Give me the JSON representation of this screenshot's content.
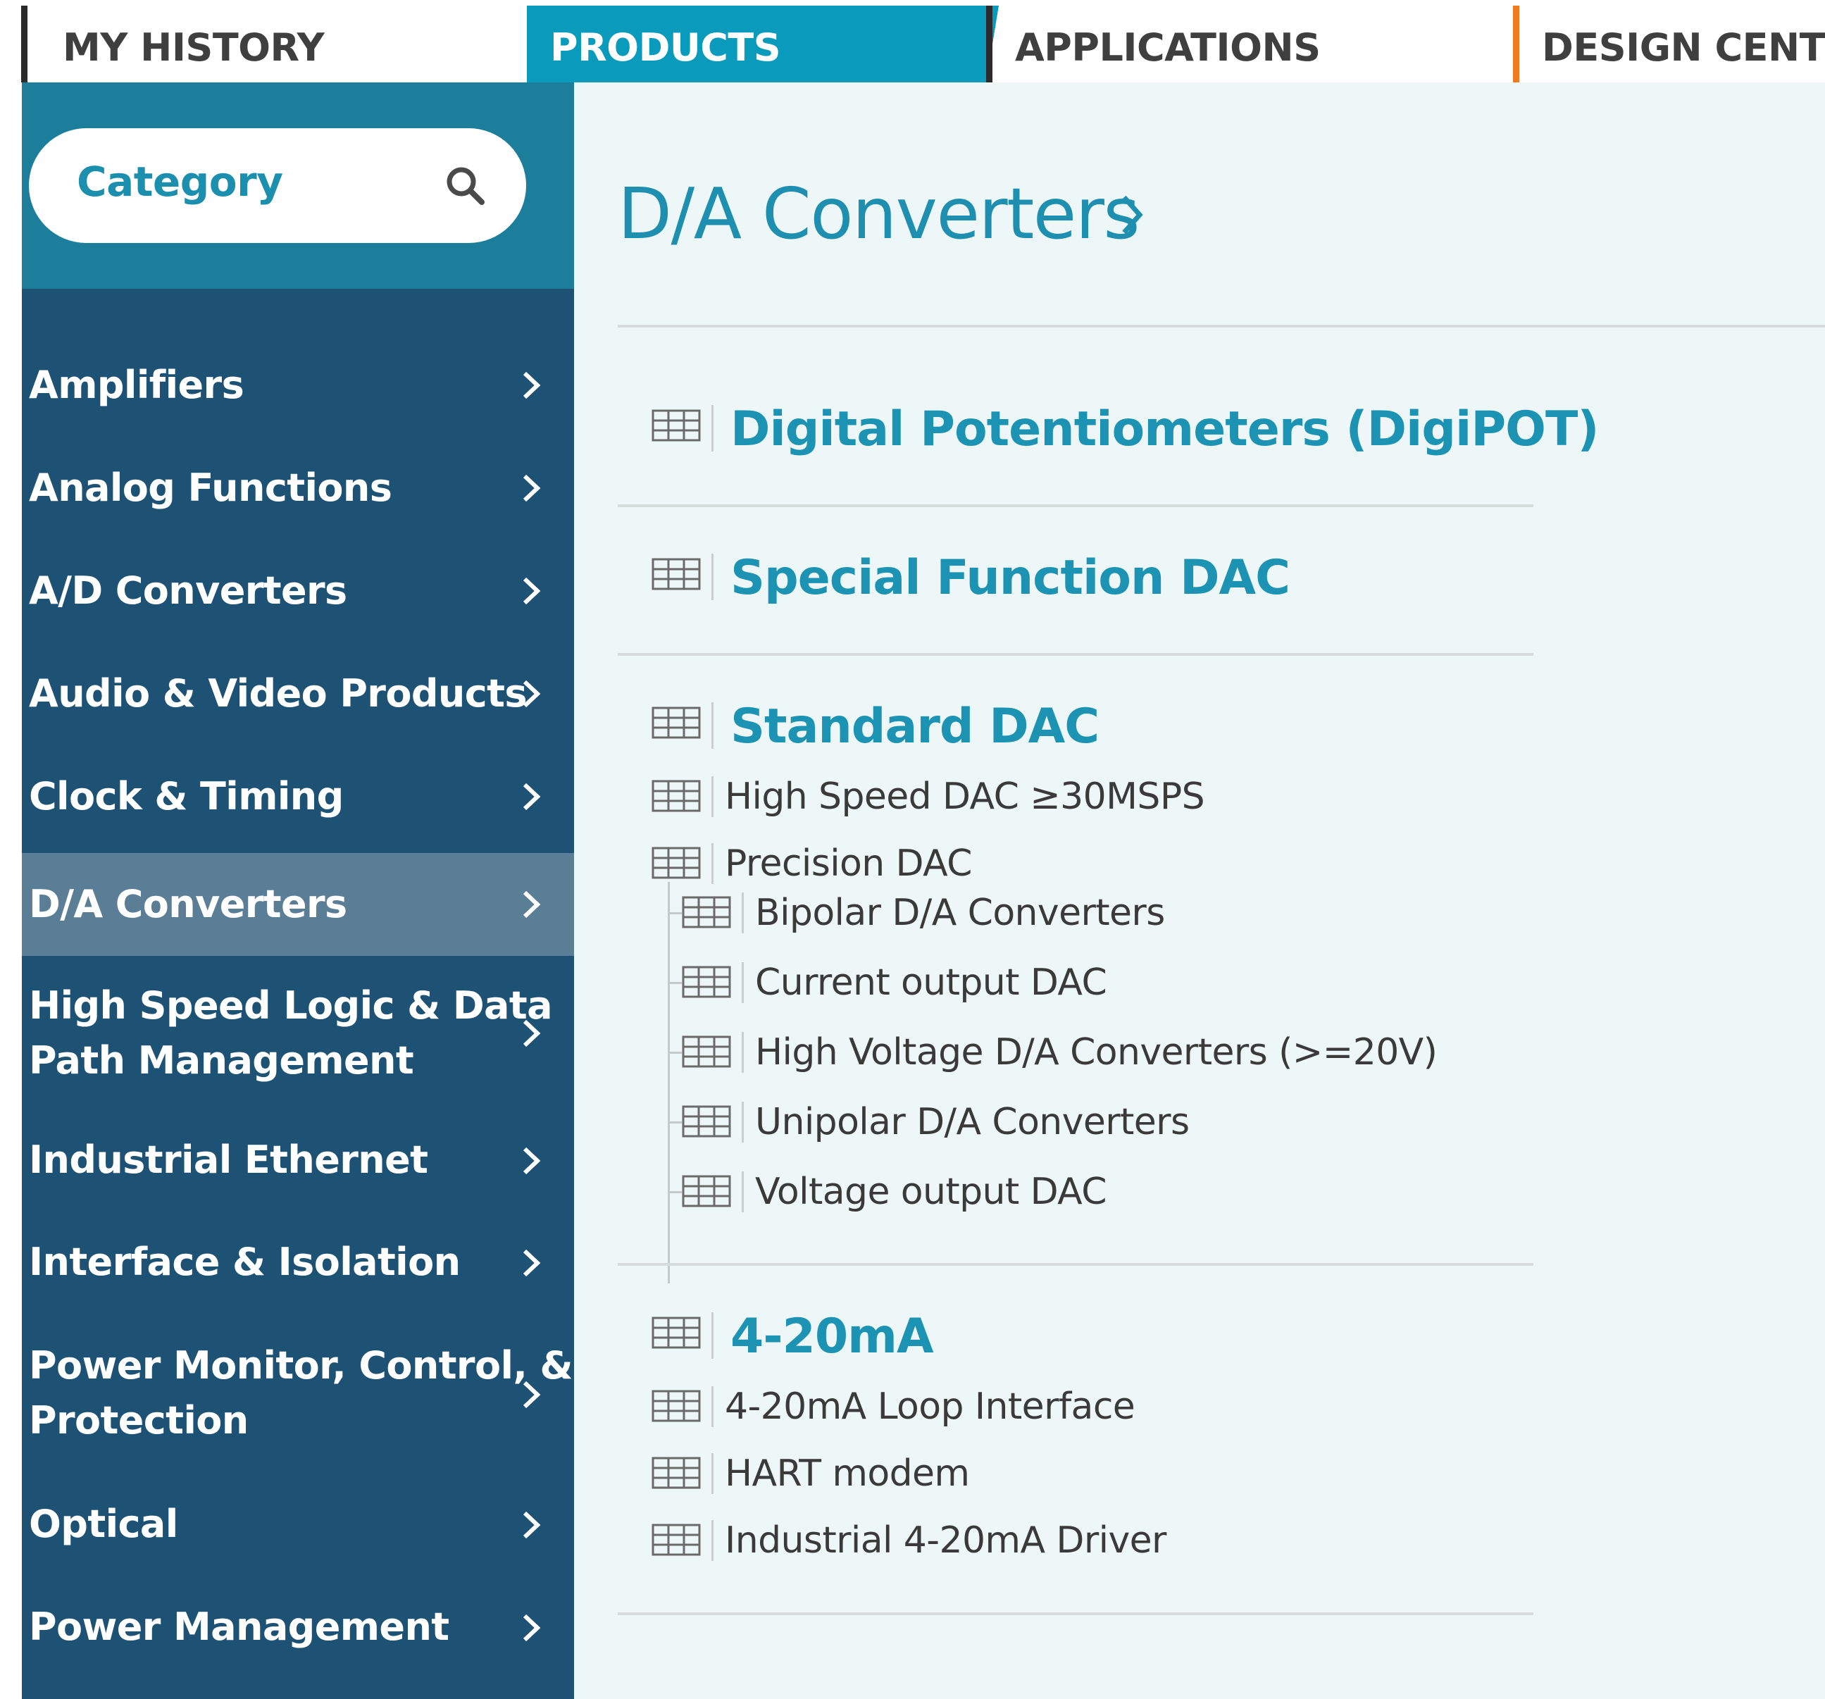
{
  "tabs": {
    "history": "MY HISTORY",
    "products": "PRODUCTS",
    "applications": "APPLICATIONS",
    "design_center": "DESIGN CENTER"
  },
  "colors": {
    "accent": "#0a9abb",
    "sidebar_bg": "#1d5274",
    "sidebar_header_bg": "#1c7e9a",
    "active_item_bg": "#5a7e95",
    "main_bg": "#eef7f8",
    "link": "#1d93b4",
    "design_center_marker": "#f07b20"
  },
  "search": {
    "placeholder": "Category",
    "icon": "search-icon"
  },
  "sidebar": {
    "items": [
      {
        "label": "Amplifiers"
      },
      {
        "label": "Analog Functions"
      },
      {
        "label": "A/D Converters"
      },
      {
        "label": "Audio & Video Products"
      },
      {
        "label": "Clock & Timing"
      },
      {
        "label": "D/A Converters",
        "active": true
      },
      {
        "label": "High Speed Logic & Data Path Management",
        "lines": [
          "High Speed Logic & Data",
          "Path Management"
        ]
      },
      {
        "label": "Industrial Ethernet"
      },
      {
        "label": "Interface & Isolation"
      },
      {
        "label": "Power Monitor, Control, & Protection",
        "lines": [
          "Power Monitor, Control, &",
          "Protection"
        ]
      },
      {
        "label": "Optical"
      },
      {
        "label": "Power Management"
      }
    ]
  },
  "main": {
    "title": "D/A Converters",
    "sections": [
      {
        "heading": "Digital Potentiometers (DigiPOT)"
      },
      {
        "heading": "Special Function DAC"
      },
      {
        "heading": "Standard DAC",
        "items": [
          {
            "label": "High Speed DAC ≥30MSPS"
          },
          {
            "label": "Precision DAC",
            "children": [
              "Bipolar D/A Converters",
              "Current output DAC",
              "High Voltage D/A Converters (>=20V)",
              "Unipolar D/A Converters",
              "Voltage output DAC"
            ]
          }
        ]
      },
      {
        "heading": "4-20mA",
        "items": [
          {
            "label": "4-20mA Loop Interface"
          },
          {
            "label": "HART modem"
          },
          {
            "label": "Industrial 4-20mA Driver"
          }
        ]
      }
    ]
  }
}
